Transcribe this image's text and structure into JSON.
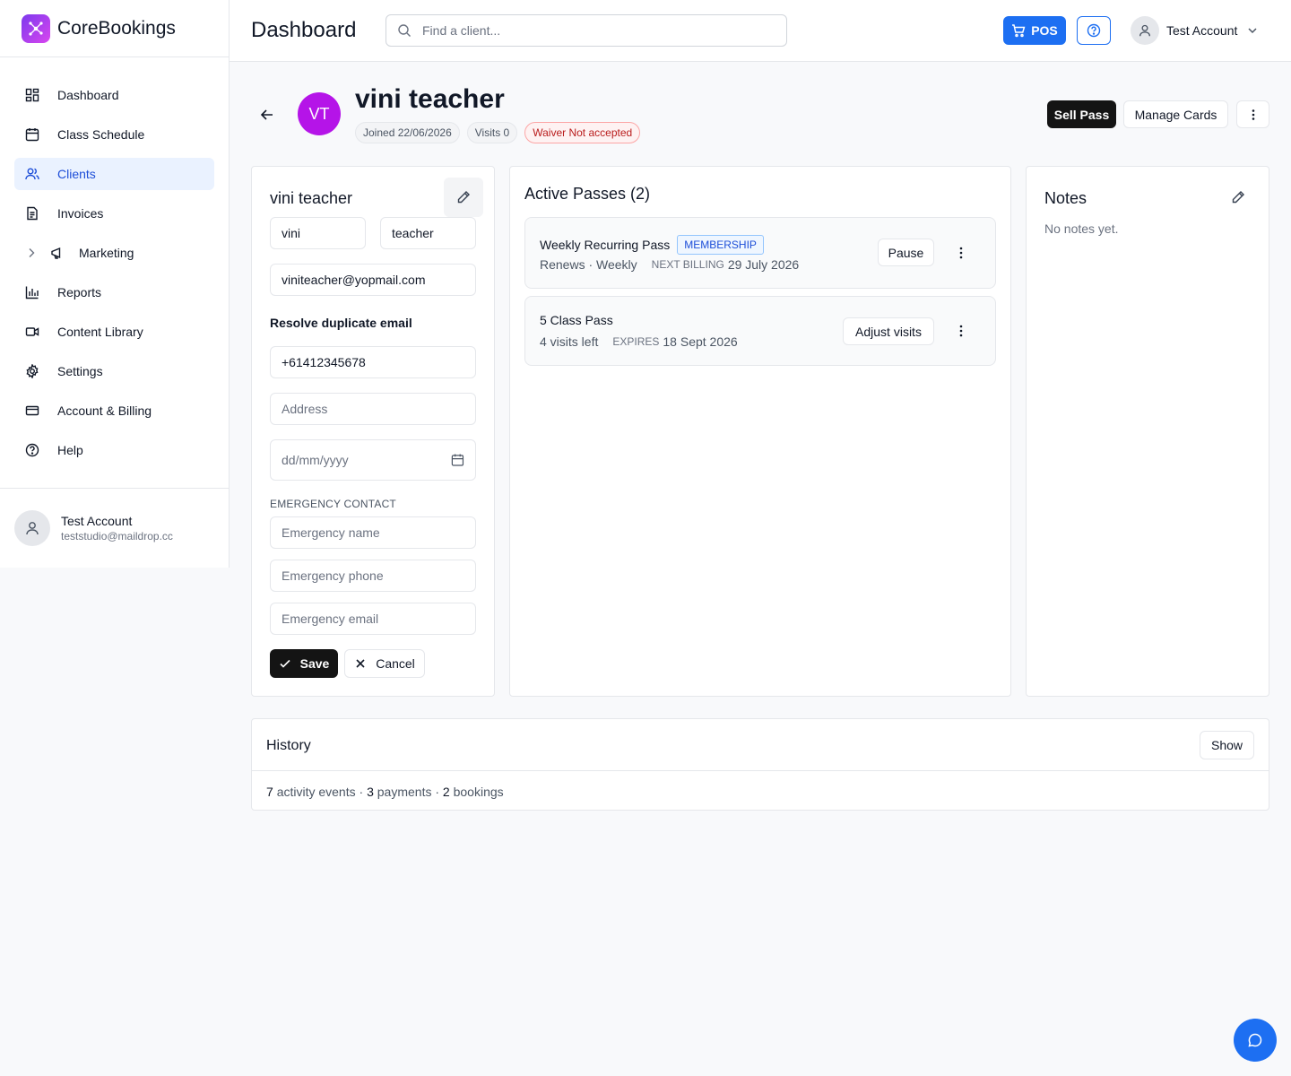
{
  "brand": {
    "name": "CoreBookings"
  },
  "sidebar": {
    "items": [
      {
        "label": "Dashboard",
        "icon": "dashboard-icon"
      },
      {
        "label": "Class Schedule",
        "icon": "calendar-icon"
      },
      {
        "label": "Clients",
        "icon": "users-icon",
        "active": true
      },
      {
        "label": "Invoices",
        "icon": "invoice-icon"
      },
      {
        "label": "Marketing",
        "icon": "megaphone-icon",
        "expandable": true
      },
      {
        "label": "Reports",
        "icon": "bar-chart-icon"
      },
      {
        "label": "Content Library",
        "icon": "video-icon"
      },
      {
        "label": "Settings",
        "icon": "gear-icon"
      },
      {
        "label": "Account & Billing",
        "icon": "credit-card-icon"
      },
      {
        "label": "Help",
        "icon": "help-circle-icon"
      }
    ],
    "user": {
      "name": "Test Account",
      "email": "teststudio@maildrop.cc"
    }
  },
  "header": {
    "title": "Dashboard",
    "search_placeholder": "Find a client...",
    "pos_label": "POS",
    "account_name": "Test Account"
  },
  "client": {
    "initials": "VT",
    "name": "vini teacher",
    "joined": "Joined 22/06/2026",
    "visits": "Visits 0",
    "waiver": "Waiver Not accepted",
    "sell_pass": "Sell Pass",
    "manage_cards": "Manage Cards"
  },
  "edit_form": {
    "title": "vini teacher",
    "first_name": "vini",
    "last_name": "teacher",
    "email": "viniteacher@yopmail.com",
    "resolve_duplicate": "Resolve duplicate email",
    "phone": "+61412345678",
    "address_placeholder": "Address",
    "dob_placeholder": "dd/mm/yyyy",
    "emergency_heading": "EMERGENCY CONTACT",
    "emergency_name_placeholder": "Emergency name",
    "emergency_phone_placeholder": "Emergency phone",
    "emergency_email_placeholder": "Emergency email",
    "save_label": "Save",
    "cancel_label": "Cancel"
  },
  "passes": {
    "title": "Active Passes (2)",
    "items": [
      {
        "name": "Weekly Recurring Pass",
        "badge": "MEMBERSHIP",
        "subtitle": "Renews · Weekly",
        "meta_label": "NEXT BILLING",
        "meta_value": "29 July 2026",
        "action": "Pause"
      },
      {
        "name": "5 Class Pass",
        "subtitle": "4 visits left",
        "meta_label": "EXPIRES",
        "meta_value": "18 Sept 2026",
        "action": "Adjust visits"
      }
    ]
  },
  "notes": {
    "title": "Notes",
    "empty": "No notes yet."
  },
  "history": {
    "title": "History",
    "show_label": "Show",
    "activity_count": "7",
    "activity_label": "activity events",
    "payments_count": "3",
    "payments_label": "payments",
    "bookings_count": "2",
    "bookings_label": "bookings"
  },
  "colors": {
    "primary": "#1d6ff2",
    "avatar": "#b514e8",
    "active_nav_bg": "#eaf2ff",
    "danger": "#b91c1c"
  }
}
